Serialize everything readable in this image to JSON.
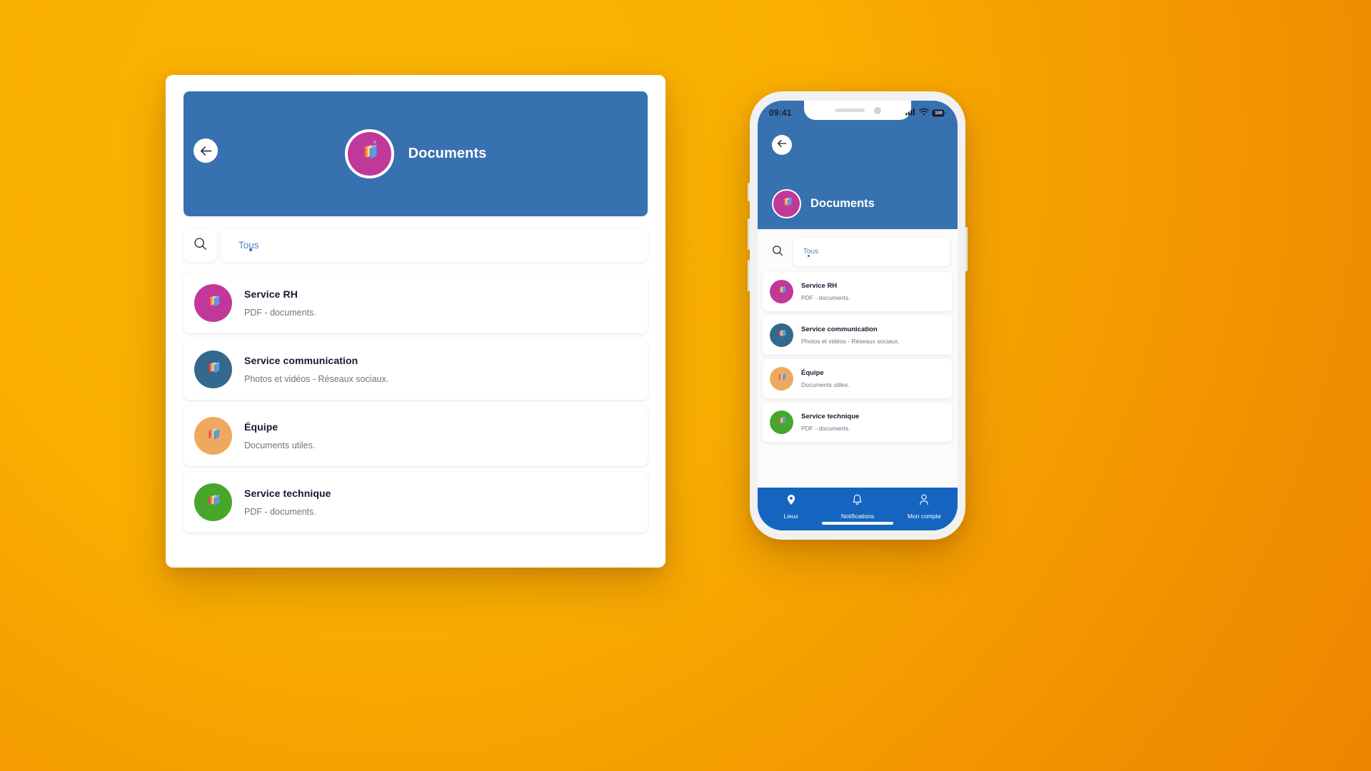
{
  "background": {
    "color_from": "#FBB505",
    "color_to": "#EE8600"
  },
  "desktop": {
    "hero": {
      "bg_color": "#3871B0",
      "back_icon": "arrow-left-icon",
      "avatar_color": "#C0399A",
      "avatar_icon": "folders-stack-icon",
      "title": "Documents"
    },
    "search": {
      "icon": "search-icon",
      "value": "Tous",
      "placeholder": "Tous"
    },
    "list": [
      {
        "title": "Service RH",
        "subtitle": "PDF - documents.",
        "avatar_color": "#C0399A",
        "icon": "folders-stack-icon"
      },
      {
        "title": "Service communication",
        "subtitle": "Photos et vidéos - Réseaux sociaux.",
        "avatar_color": "#34688C",
        "icon": "folders-stack-icon"
      },
      {
        "title": "Équipe",
        "subtitle": "Documents utiles.",
        "avatar_color": "#EFA95E",
        "icon": "folders-stack-icon"
      },
      {
        "title": "Service technique",
        "subtitle": "PDF - documents.",
        "avatar_color": "#47A72B",
        "icon": "folders-stack-icon"
      }
    ]
  },
  "phone": {
    "status": {
      "time": "09:41",
      "signal_icon": "cellular-signal-icon",
      "wifi_icon": "wifi-icon",
      "battery_icon": "battery-icon",
      "battery_level": "100"
    },
    "hero": {
      "bg_color": "#3871B0",
      "back_icon": "arrow-left-icon",
      "avatar_color": "#C0399A",
      "avatar_icon": "folders-stack-icon",
      "title": "Documents"
    },
    "search": {
      "icon": "search-icon",
      "value": "Tous",
      "placeholder": "Tous"
    },
    "list": [
      {
        "title": "Service RH",
        "subtitle": "PDF - documents.",
        "avatar_color": "#C0399A",
        "icon": "folders-stack-icon"
      },
      {
        "title": "Service communication",
        "subtitle": "Photos et vidéos - Réseaux sociaux.",
        "avatar_color": "#34688C",
        "icon": "folders-stack-icon"
      },
      {
        "title": "Équipe",
        "subtitle": "Documents utiles.",
        "avatar_color": "#EFA95E",
        "icon": "folders-stack-icon"
      },
      {
        "title": "Service technique",
        "subtitle": "PDF - documents.",
        "avatar_color": "#47A72B",
        "icon": "folders-stack-icon"
      }
    ],
    "tabbar": {
      "bg_color": "#1565C0",
      "tabs": [
        {
          "label": "Lieux",
          "icon": "map-pin-icon"
        },
        {
          "label": "Notifications",
          "icon": "bell-icon"
        },
        {
          "label": "Mon compte",
          "icon": "person-icon"
        }
      ]
    }
  }
}
